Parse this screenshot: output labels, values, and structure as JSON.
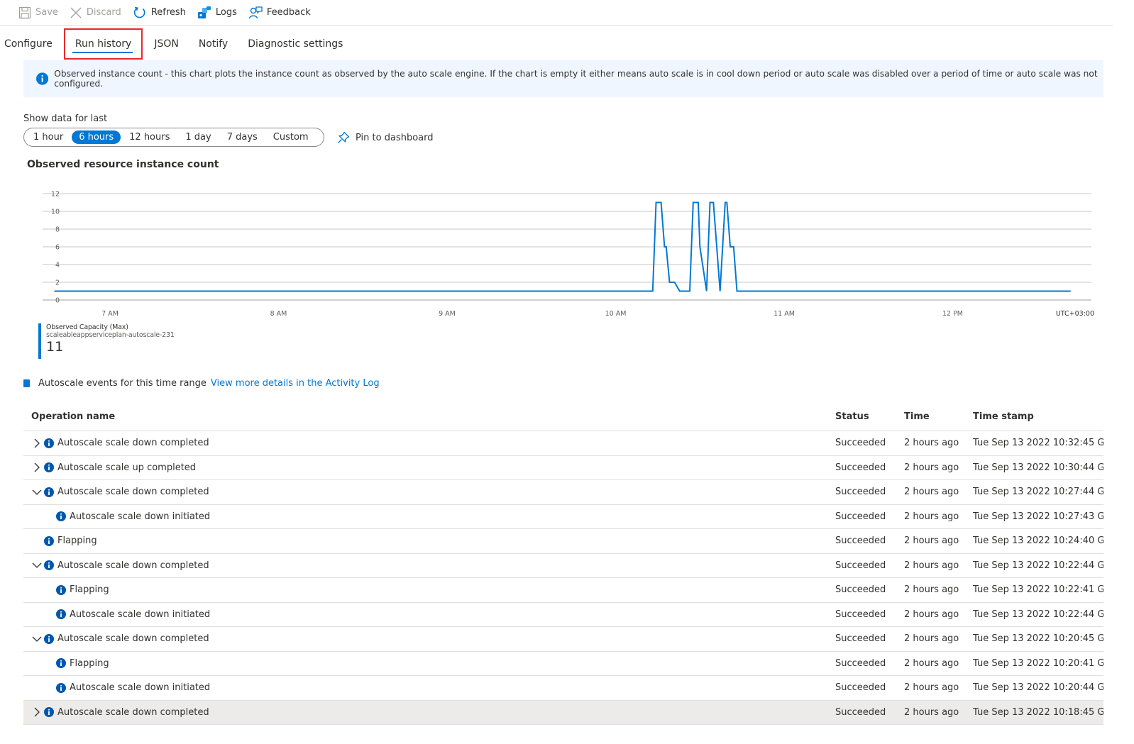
{
  "toolbar": {
    "save": "Save",
    "discard": "Discard",
    "refresh": "Refresh",
    "logs": "Logs",
    "feedback": "Feedback"
  },
  "tabs": [
    "Configure",
    "Run history",
    "JSON",
    "Notify",
    "Diagnostic settings"
  ],
  "active_tab": "Run history",
  "banner": "Observed instance count - this chart plots the instance count as observed by the auto scale engine. If the chart is empty it either means auto scale is in cool down period or auto scale was disabled over a period of time or auto scale was not configured.",
  "range": {
    "label": "Show data for last",
    "options": [
      "1 hour",
      "6 hours",
      "12 hours",
      "1 day",
      "7 days",
      "Custom"
    ],
    "selected": "6 hours",
    "pin": "Pin to dashboard"
  },
  "chart_title": "Observed resource instance count",
  "chart_data": {
    "type": "line",
    "title": "Observed resource instance count",
    "ylim": [
      0,
      12
    ],
    "y_ticks": [
      "0",
      "2",
      "4",
      "6",
      "8",
      "10",
      "12"
    ],
    "x_ticks": [
      "7 AM",
      "8 AM",
      "9 AM",
      "10 AM",
      "11 AM",
      "12 PM"
    ],
    "timezone": "UTC+03:00",
    "grid": true,
    "color": "#0078d4",
    "series": [
      {
        "name": "Observed Capacity (Max)",
        "x_hours": [
          6.67,
          10.22,
          10.24,
          10.27,
          10.29,
          10.3,
          10.31,
          10.32,
          10.35,
          10.38,
          10.44,
          10.46,
          10.49,
          10.5,
          10.54,
          10.56,
          10.58,
          10.6,
          10.62,
          10.65,
          10.66,
          10.68,
          10.7,
          10.72,
          10.74,
          10.76,
          10.77,
          12.7
        ],
        "values": [
          1,
          1,
          11,
          11,
          6,
          6,
          4,
          2,
          2,
          1,
          1,
          11,
          11,
          6,
          1,
          11,
          11,
          6,
          1,
          11,
          11,
          6,
          6,
          1,
          1,
          1,
          1,
          1
        ]
      }
    ]
  },
  "legend": {
    "metric": "Observed Capacity (Max)",
    "resource": "scaleableappserviceplan-autoscale-231",
    "value": "11"
  },
  "events": {
    "label": "Autoscale events for this time range",
    "link": "View more details in the Activity Log"
  },
  "table": {
    "headers": {
      "op": "Operation name",
      "status": "Status",
      "time": "Time",
      "timestamp": "Time stamp"
    },
    "rows": [
      {
        "op": "Autoscale scale down completed",
        "status": "Succeeded",
        "time": "2 hours ago",
        "ts": "Tue Sep 13 2022 10:32:45 G...",
        "level": 0,
        "exp": "collapsed"
      },
      {
        "op": "Autoscale scale up completed",
        "status": "Succeeded",
        "time": "2 hours ago",
        "ts": "Tue Sep 13 2022 10:30:44 G...",
        "level": 0,
        "exp": "collapsed"
      },
      {
        "op": "Autoscale scale down completed",
        "status": "Succeeded",
        "time": "2 hours ago",
        "ts": "Tue Sep 13 2022 10:27:44 G...",
        "level": 0,
        "exp": "expanded"
      },
      {
        "op": "Autoscale scale down initiated",
        "status": "Succeeded",
        "time": "2 hours ago",
        "ts": "Tue Sep 13 2022 10:27:43 G...",
        "level": 1,
        "exp": "none"
      },
      {
        "op": "Flapping",
        "status": "Succeeded",
        "time": "2 hours ago",
        "ts": "Tue Sep 13 2022 10:24:40 G...",
        "level": 0,
        "exp": "none"
      },
      {
        "op": "Autoscale scale down completed",
        "status": "Succeeded",
        "time": "2 hours ago",
        "ts": "Tue Sep 13 2022 10:22:44 G...",
        "level": 0,
        "exp": "expanded"
      },
      {
        "op": "Flapping",
        "status": "Succeeded",
        "time": "2 hours ago",
        "ts": "Tue Sep 13 2022 10:22:41 G...",
        "level": 1,
        "exp": "none"
      },
      {
        "op": "Autoscale scale down initiated",
        "status": "Succeeded",
        "time": "2 hours ago",
        "ts": "Tue Sep 13 2022 10:22:44 G...",
        "level": 1,
        "exp": "none"
      },
      {
        "op": "Autoscale scale down completed",
        "status": "Succeeded",
        "time": "2 hours ago",
        "ts": "Tue Sep 13 2022 10:20:45 G...",
        "level": 0,
        "exp": "expanded"
      },
      {
        "op": "Flapping",
        "status": "Succeeded",
        "time": "2 hours ago",
        "ts": "Tue Sep 13 2022 10:20:41 G...",
        "level": 1,
        "exp": "none"
      },
      {
        "op": "Autoscale scale down initiated",
        "status": "Succeeded",
        "time": "2 hours ago",
        "ts": "Tue Sep 13 2022 10:20:44 G...",
        "level": 1,
        "exp": "none"
      },
      {
        "op": "Autoscale scale down completed",
        "status": "Succeeded",
        "time": "2 hours ago",
        "ts": "Tue Sep 13 2022 10:18:45 G...",
        "level": 0,
        "exp": "collapsed",
        "highlighted": true
      }
    ]
  }
}
